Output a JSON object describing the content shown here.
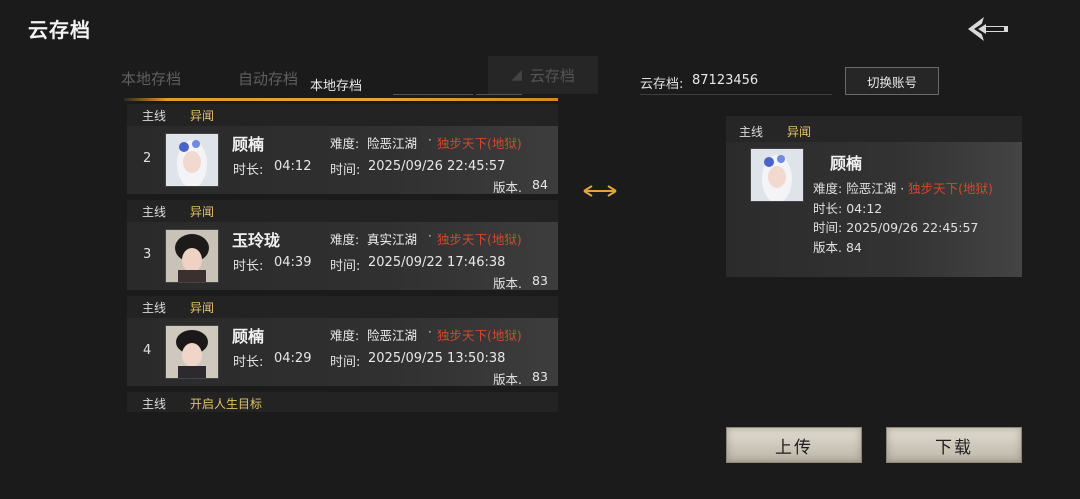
{
  "header": {
    "title": "云存档",
    "back_icon": "back-arrow-icon"
  },
  "tabs": {
    "local_bg": "本地存档",
    "auto": "自动存档",
    "local_active": "本地存档",
    "cloud": "云存档"
  },
  "save_slots": [
    {
      "tag_main": "主线",
      "tag_sub": "异闻",
      "index": "2",
      "name": "顾楠",
      "difficulty_label": "难度:",
      "difficulty": "险恶江湖",
      "dot": "·",
      "mode": "独步天下(地狱)",
      "duration_label": "时长:",
      "duration": "04:12",
      "time_label": "时间:",
      "time": "2025/09/26 22:45:57",
      "version_label": "版本.",
      "version": "84"
    },
    {
      "tag_main": "主线",
      "tag_sub": "异闻",
      "index": "3",
      "name": "玉玲珑",
      "difficulty_label": "难度:",
      "difficulty": "真实江湖",
      "dot": "·",
      "mode": "独步天下(地狱)",
      "duration_label": "时长:",
      "duration": "04:39",
      "time_label": "时间:",
      "time": "2025/09/22 17:46:38",
      "version_label": "版本.",
      "version": "83"
    },
    {
      "tag_main": "主线",
      "tag_sub": "异闻",
      "index": "4",
      "name": "顾楠",
      "difficulty_label": "难度:",
      "difficulty": "险恶江湖",
      "dot": "·",
      "mode": "独步天下(地狱)",
      "duration_label": "时长:",
      "duration": "04:29",
      "time_label": "时间:",
      "time": "2025/09/25 13:50:38",
      "version_label": "版本.",
      "version": "83"
    },
    {
      "tag_main": "主线",
      "tag_sub": "开启人生目标"
    }
  ],
  "cloud": {
    "label": "云存档:",
    "id": "87123456",
    "switch_label": "切换账号",
    "save": {
      "tag_main": "主线",
      "tag_sub": "异闻",
      "name": "顾楠",
      "difficulty_label": "难度:",
      "difficulty": "险恶江湖",
      "dot": "·",
      "mode": "独步天下(地狱)",
      "duration_label": "时长:",
      "duration": "04:12",
      "time_label": "时间:",
      "time": "2025/09/26 22:45:57",
      "version_label": "版本.",
      "version": "84"
    }
  },
  "actions": {
    "upload": "上传",
    "download": "下载"
  },
  "colors": {
    "accent_orange": "#e6a23c",
    "tag_gold": "#e2c26a",
    "mode_red": "#d0492f"
  }
}
